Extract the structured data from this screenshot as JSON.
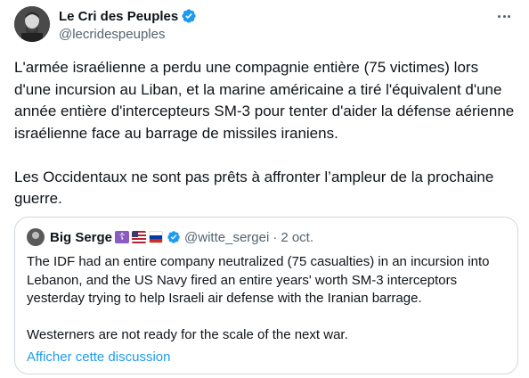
{
  "author": {
    "display_name": "Le Cri des Peuples",
    "handle": "@lecridespeuples"
  },
  "tweet": {
    "text": "L'armée israélienne a perdu une compagnie entière (75 victimes) lors d'une incursion au Liban, et la marine américaine a tiré l'équivalent d'une année entière d'intercepteurs SM-3 pour tenter d'aider la défense aérienne israélienne face au barrage de missiles iraniens.\n\nLes Occidentaux ne sont pas prêts à affronter l’ampleur de la prochaine guerre."
  },
  "quoted": {
    "display_name": "Big Serge",
    "badge_cross": "☦",
    "handle": "@witte_sergei",
    "separator": "·",
    "date": "2 oct.",
    "text": "The IDF had an entire company neutralized (75 casualties) in an incursion into Lebanon, and the US Navy fired an entire years' worth SM-3 interceptors yesterday trying to help Israeli air defense with the Iranian barrage.\n\nWesterners are not ready for the scale of the next war.",
    "link_label": "Afficher cette discussion"
  },
  "icons": {
    "verified": "verified-badge-icon",
    "more": "more-dots-icon"
  },
  "colors": {
    "accent": "#1d9bf0",
    "text": "#0f1419",
    "muted": "#536471",
    "border": "#cfd9de"
  }
}
